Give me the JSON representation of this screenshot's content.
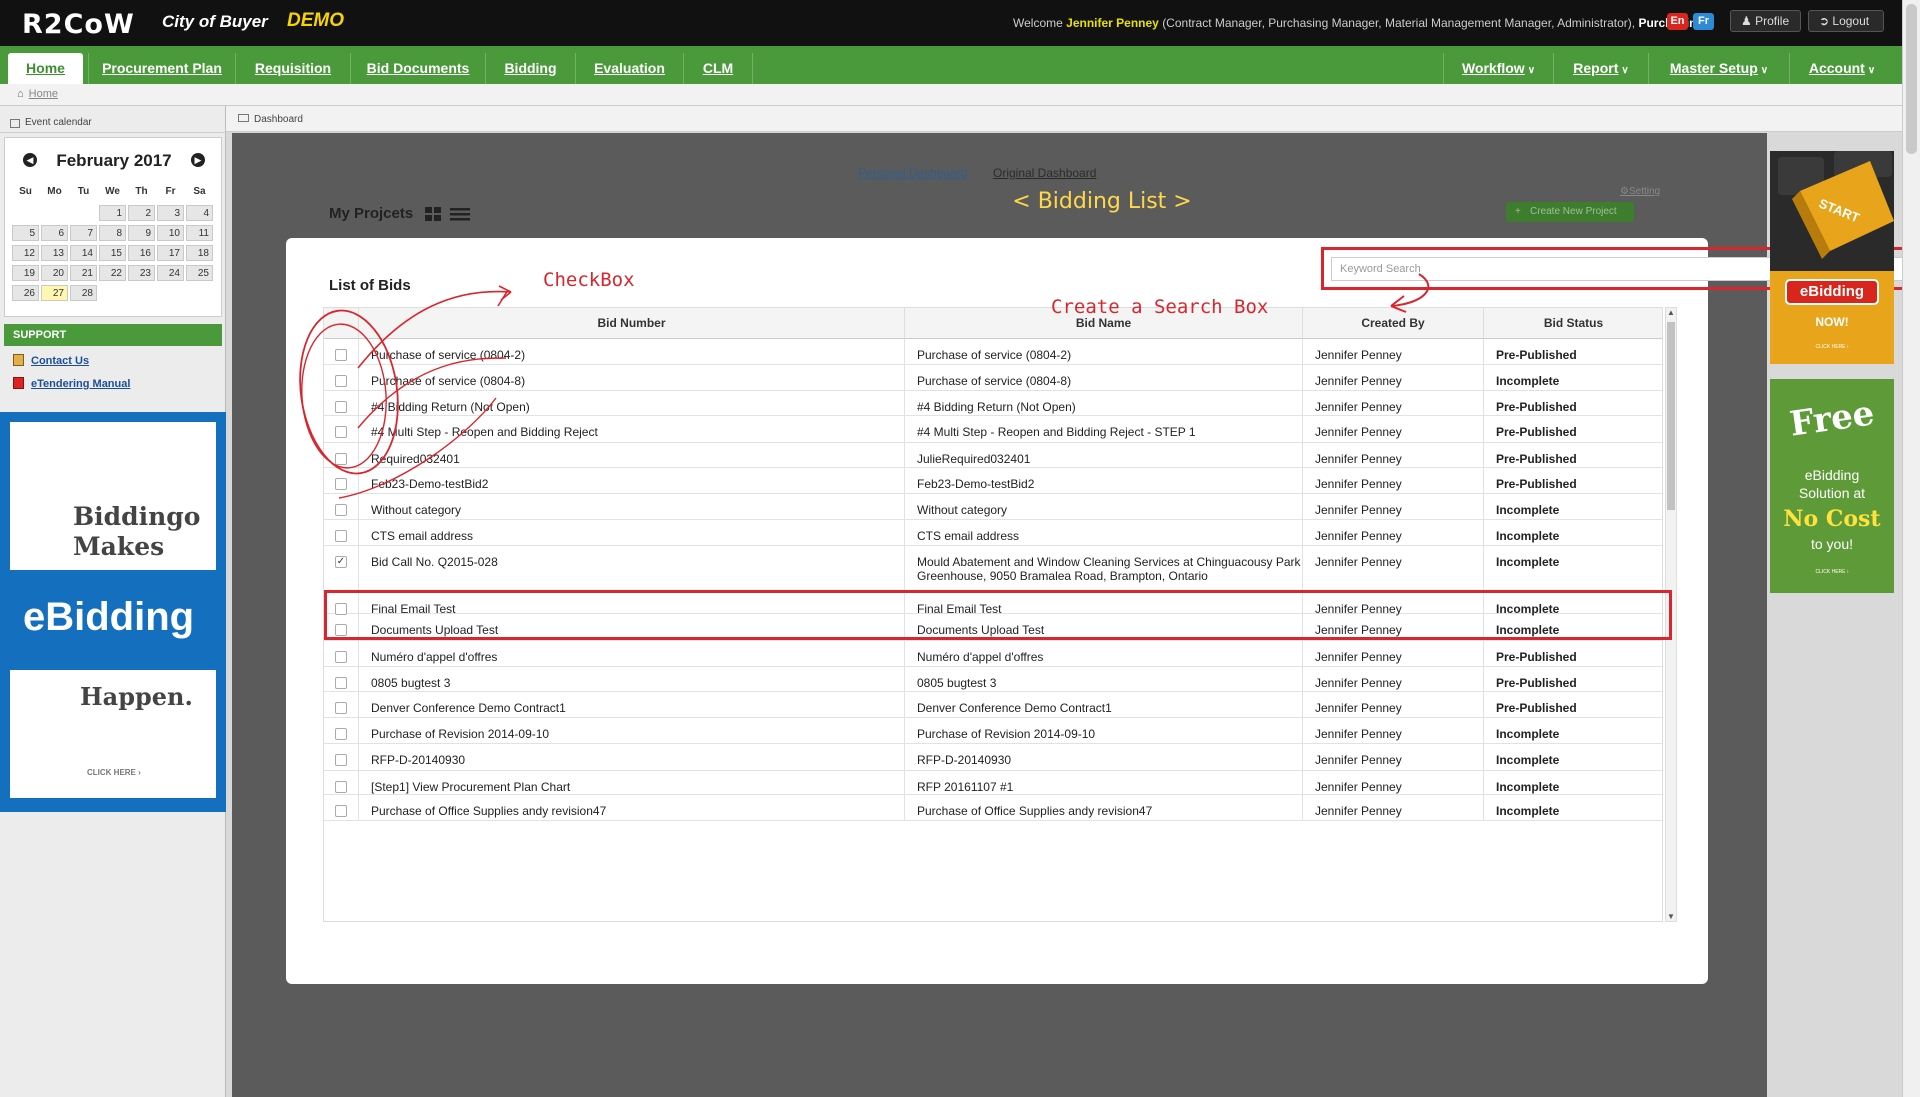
{
  "header": {
    "logo": "R2CoW",
    "city": "City of Buyer",
    "demo": "DEMO",
    "welcome_prefix": "Welcome",
    "user_name": "Jennifer Penney",
    "roles": "(Contract Manager, Purchasing Manager, Material Management Manager, Administrator),",
    "department": "Purchasing",
    "lang_en": "En",
    "lang_fr": "Fr",
    "profile_label": "Profile",
    "logout_label": "Logout"
  },
  "nav": {
    "left": [
      "Home",
      "Procurement Plan",
      "Requisition",
      "Bid Documents",
      "Bidding",
      "Evaluation",
      "CLM"
    ],
    "right": [
      "Workflow",
      "Report",
      "Master Setup",
      "Account"
    ],
    "active": "Home"
  },
  "breadcrumb": {
    "home": "Home"
  },
  "sidebar": {
    "event_calendar_label": "Event calendar",
    "calendar": {
      "title": "February 2017",
      "days_of_week": [
        "Su",
        "Mo",
        "Tu",
        "We",
        "Th",
        "Fr",
        "Sa"
      ],
      "weeks": [
        [
          "",
          "",
          "",
          "1",
          "2",
          "3",
          "4"
        ],
        [
          "5",
          "6",
          "7",
          "8",
          "9",
          "10",
          "11"
        ],
        [
          "12",
          "13",
          "14",
          "15",
          "16",
          "17",
          "18"
        ],
        [
          "19",
          "20",
          "21",
          "22",
          "23",
          "24",
          "25"
        ],
        [
          "26",
          "27",
          "28",
          "",
          "",
          "",
          ""
        ]
      ],
      "today": "27"
    },
    "support_title": "SUPPORT",
    "support_links": [
      "Contact Us",
      "eTendering Manual"
    ],
    "ad": {
      "line1": "Biddingo",
      "line2": "Makes",
      "line3": "eBidding",
      "line4": "Happen.",
      "cta": "CLICK HERE ›"
    }
  },
  "main": {
    "section_label": "Dashboard",
    "personal_dashboard": "Personal Dashboard",
    "original_dashboard": "Original Dashboard",
    "page_title": "< Bidding List >",
    "my_projects": "My Projcets",
    "setting_label": "Setting",
    "create_project_label": "Create New Project",
    "list_title": "List of Bids",
    "search_placeholder": "Keyword Search",
    "annotations": {
      "checkbox": "CheckBox",
      "search_box": "Create a Search Box"
    },
    "columns": [
      "Bid Number",
      "Bid Name",
      "Created By",
      "Bid Status"
    ],
    "rows": [
      {
        "number": "Purchase of service (0804-2)",
        "name": "Purchase of service (0804-2)",
        "created_by": "Jennifer Penney",
        "status": "Pre-Published",
        "checked": false
      },
      {
        "number": "Purchase of service (0804-8)",
        "name": "Purchase of service (0804-8)",
        "created_by": "Jennifer Penney",
        "status": "Incomplete",
        "checked": false
      },
      {
        "number": "#4 Bidding Return (Not Open)",
        "name": "#4 Bidding Return (Not Open)",
        "created_by": "Jennifer Penney",
        "status": "Pre-Published",
        "checked": false
      },
      {
        "number": "#4 Multi Step - Reopen and Bidding Reject",
        "name": "#4 Multi Step - Reopen and Bidding Reject - STEP 1",
        "created_by": "Jennifer Penney",
        "status": "Pre-Published",
        "checked": false
      },
      {
        "number": "Required032401",
        "name": "JulieRequired032401",
        "created_by": "Jennifer Penney",
        "status": "Pre-Published",
        "checked": false
      },
      {
        "number": "Feb23-Demo-testBid2",
        "name": "Feb23-Demo-testBid2",
        "created_by": "Jennifer Penney",
        "status": "Pre-Published",
        "checked": false
      },
      {
        "number": "Without category",
        "name": "Without category",
        "created_by": "Jennifer Penney",
        "status": "Incomplete",
        "checked": false
      },
      {
        "number": "CTS email address",
        "name": "CTS email address",
        "created_by": "Jennifer Penney",
        "status": "Incomplete",
        "checked": false
      },
      {
        "number": "Bid Call No. Q2015-028",
        "name": "Mould Abatement and Window Cleaning Services at Chinguacousy Park Greenhouse, 9050 Bramalea Road, Brampton, Ontario",
        "created_by": "Jennifer Penney",
        "status": "Incomplete",
        "checked": true
      },
      {
        "number": "Final Email Test",
        "name": "Final Email Test",
        "created_by": "Jennifer Penney",
        "status": "Incomplete",
        "checked": false
      },
      {
        "number": "Documents Upload Test",
        "name": "Documents Upload Test",
        "created_by": "Jennifer Penney",
        "status": "Incomplete",
        "checked": false
      },
      {
        "number": "Numéro d'appel d'offres",
        "name": "Numéro d'appel d'offres",
        "created_by": "Jennifer Penney",
        "status": "Pre-Published",
        "checked": false
      },
      {
        "number": "0805 bugtest 3",
        "name": "0805 bugtest 3",
        "created_by": "Jennifer Penney",
        "status": "Pre-Published",
        "checked": false
      },
      {
        "number": "Denver Conference Demo Contract1",
        "name": "Denver Conference Demo Contract1",
        "created_by": "Jennifer Penney",
        "status": "Pre-Published",
        "checked": false
      },
      {
        "number": "Purchase of Revision 2014-09-10",
        "name": "Purchase of Revision 2014-09-10",
        "created_by": "Jennifer Penney",
        "status": "Incomplete",
        "checked": false
      },
      {
        "number": "RFP-D-20140930",
        "name": "RFP-D-20140930",
        "created_by": "Jennifer Penney",
        "status": "Incomplete",
        "checked": false
      },
      {
        "number": "[Step1] View Procurement Plan Chart",
        "name": "RFP 20161107 #1",
        "created_by": "Jennifer Penney",
        "status": "Incomplete",
        "checked": false
      },
      {
        "number": "Purchase of Office Supplies andy revision47",
        "name": "Purchase of Office Supplies andy revision47",
        "created_by": "Jennifer Penney",
        "status": "Incomplete",
        "checked": false
      }
    ]
  },
  "right_ads": {
    "ad1_key": "START",
    "ad1_button": "eBidding",
    "ad1_now": "NOW!",
    "ad1_cta": "CLICK HERE ›",
    "ad2_free": "Free",
    "ad2_line1": "eBidding",
    "ad2_line2": "Solution at",
    "ad2_line3": "No Cost",
    "ad2_line4": "to you!",
    "ad2_cta": "CLICK HERE ›"
  },
  "colors": {
    "nav_green": "#4a9a3b",
    "annotation_red": "#d9262e",
    "title_yellow": "#ffd84a"
  }
}
